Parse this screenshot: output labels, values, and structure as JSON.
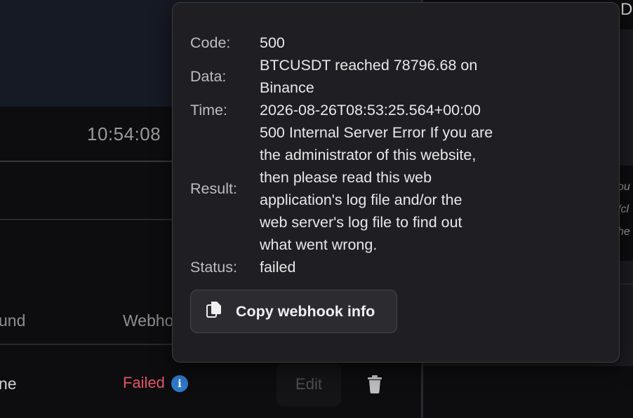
{
  "background": {
    "time": "10:54:08",
    "table_headers": {
      "round": "und",
      "webhook": "Webho"
    },
    "row": {
      "name": "ne",
      "status": "Failed",
      "edit_label": "Edit"
    },
    "right_top_fragment": "D",
    "right_fragments": [
      "ou",
      "/cl",
      "he"
    ]
  },
  "popover": {
    "fields": [
      {
        "label": "Code:",
        "value": "500"
      },
      {
        "label": "Data:",
        "value_lines": [
          "BTCUSDT reached 78796.68 on",
          "Binance"
        ]
      },
      {
        "label": "Time:",
        "value": "2026-08-26T08:53:25.564+00:00"
      },
      {
        "label": "Result:",
        "value_lines": [
          "500 Internal Server Error If you are",
          "the administrator of this website,",
          "then please read this web",
          "application's log file and/or the",
          "web server's log file to find out",
          "what went wrong."
        ]
      },
      {
        "label": "Status:",
        "value": "failed"
      }
    ],
    "copy_button": "Copy webhook info"
  },
  "colors": {
    "failed_red": "#e25563",
    "info_blue": "#2f79c9",
    "popover_bg": "#1f1f23"
  },
  "icons": [
    "info-icon",
    "trash-icon",
    "copy-icon"
  ]
}
